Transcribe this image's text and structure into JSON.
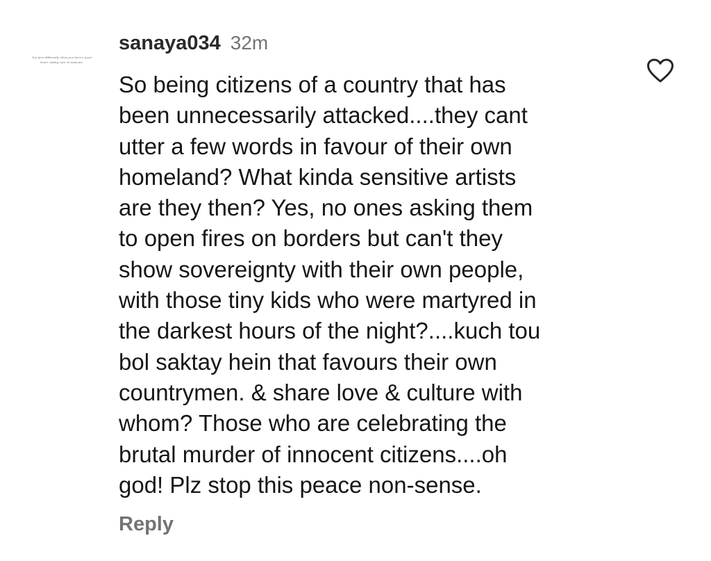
{
  "comment": {
    "avatar_text": [
      "You give differently when you have a good",
      "heart, taking care of someone."
    ],
    "username": "sanaya034",
    "timestamp": "32m",
    "body_lines": [
      "So being citizens of a country that has",
      "been unnecessarily attacked....they cant",
      "utter a few words in favour of their own",
      "homeland? What kinda sensitive artists",
      "are they then? Yes, no ones asking them",
      "to open fires on borders but can't they",
      "show sovereignty with their own people,",
      "with those tiny kids who were martyred in",
      "the darkest hours of the night?....kuch tou",
      "bol saktay hein that favours their own",
      "countrymen. & share love & culture with",
      "whom? Those who are celebrating the",
      "brutal murder of innocent citizens....oh",
      "god! Plz stop this peace non-sense."
    ],
    "reply_label": "Reply",
    "like_icon": "heart-outline-icon"
  },
  "colors": {
    "text": "#161616",
    "username": "#2a2a2a",
    "muted": "#737373",
    "icon": "#262626",
    "background": "#ffffff"
  }
}
